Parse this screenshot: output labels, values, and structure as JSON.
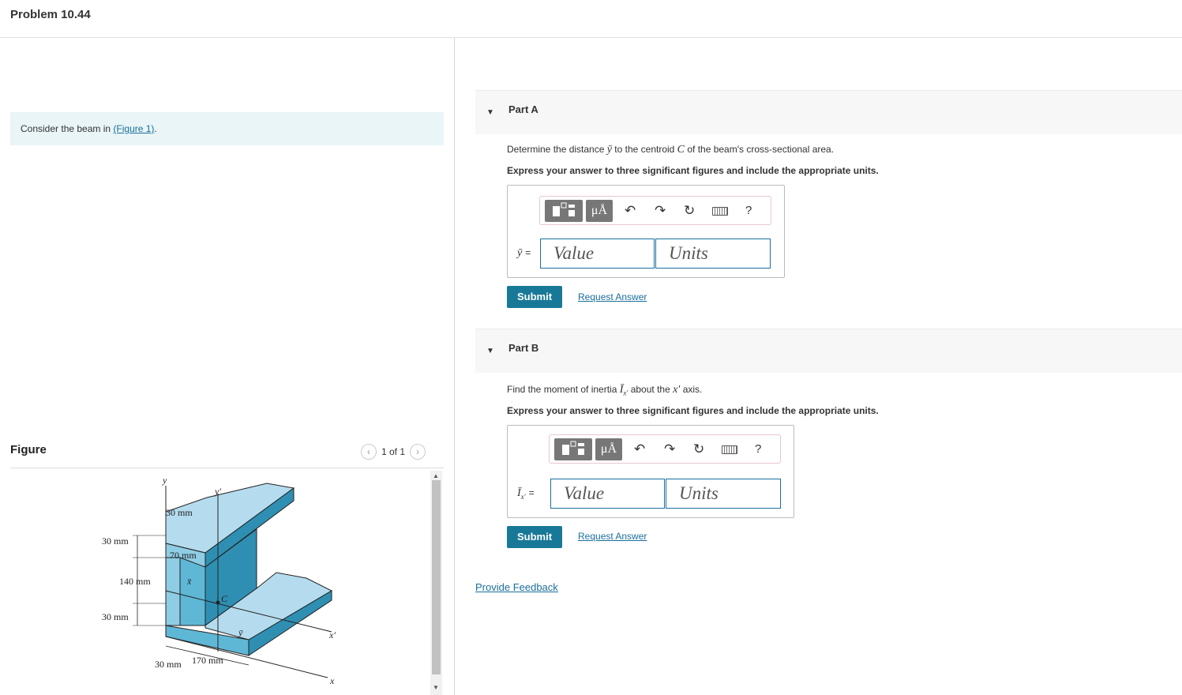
{
  "header": {
    "title": "Problem 10.44"
  },
  "intro": {
    "text": "Consider the beam in ",
    "link": "(Figure 1)",
    "end": "."
  },
  "figure": {
    "heading": "Figure",
    "counter": "1 of 1",
    "prev_icon": "‹",
    "next_icon": "›",
    "labels": {
      "y": "y",
      "yprime": "y′",
      "d30top": "30 mm",
      "d70": "70 mm",
      "d30left": "30 mm",
      "d140": "140 mm",
      "d30bottom": "30 mm",
      "xbar": "x̄",
      "c": "C",
      "ybar": "ȳ",
      "xprime": "x′",
      "x": "x",
      "d30base": "30 mm",
      "d170": "170 mm"
    }
  },
  "partA": {
    "label": "Part A",
    "question_pre": "Determine the distance ",
    "question_sym": "ȳ",
    "question_mid": " to the centroid ",
    "question_c": "C",
    "question_post": " of the beam's cross-sectional area.",
    "instruction": "Express your answer to three significant figures and include the appropriate units.",
    "var_label": "ȳ",
    "eq": "=",
    "value_placeholder": "Value",
    "units_placeholder": "Units",
    "submit": "Submit",
    "request": "Request Answer"
  },
  "partB": {
    "label": "Part B",
    "question_pre": "Find the moment of inertia ",
    "question_sym": "Ī",
    "question_sub": "x′",
    "question_mid": " about the ",
    "question_axis": "x′",
    "question_post": " axis.",
    "instruction": "Express your answer to three significant figures and include the appropriate units.",
    "var_label": "Ī",
    "var_sub": "x′",
    "eq": "=",
    "value_placeholder": "Value",
    "units_placeholder": "Units",
    "submit": "Submit",
    "request": "Request Answer"
  },
  "toolbar": {
    "units_label": "μÅ",
    "undo_icon": "↶",
    "redo_icon": "↷",
    "reset_icon": "↻",
    "help_label": "?"
  },
  "footer": {
    "feedback": "Provide Feedback"
  },
  "colors": {
    "accent": "#187897",
    "link": "#1a6f9c",
    "beam_light": "#b5dcee",
    "beam_mid": "#5fb7d6",
    "beam_dark": "#2f8fb2"
  }
}
